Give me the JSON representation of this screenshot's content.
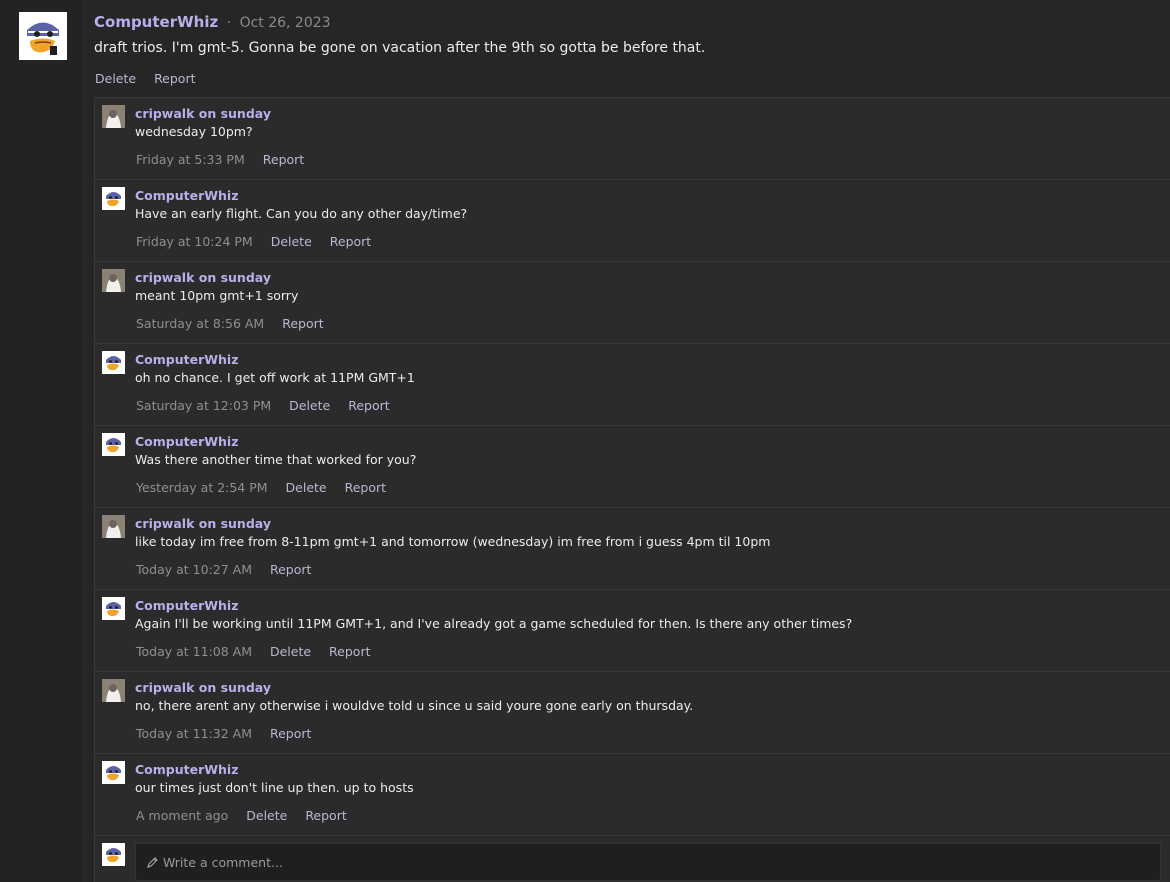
{
  "post": {
    "author": "ComputerWhiz",
    "separator": "·",
    "date": "Oct 26, 2023",
    "body": "draft trios. I'm gmt-5. Gonna be gone on vacation after the 9th so gotta be before that.",
    "actions": {
      "delete": "Delete",
      "report": "Report"
    }
  },
  "comments": [
    {
      "author": "cripwalk on sunday",
      "avatar": "user-photo",
      "text": "wednesday 10pm?",
      "time": "Friday at 5:33 PM",
      "delete": "",
      "report": "Report"
    },
    {
      "author": "ComputerWhiz",
      "avatar": "duck-avatar",
      "text": "Have an early flight. Can you do any other day/time?",
      "time": "Friday at 10:24 PM",
      "delete": "Delete",
      "report": "Report"
    },
    {
      "author": "cripwalk on sunday",
      "avatar": "user-photo",
      "text": "meant 10pm gmt+1 sorry",
      "time": "Saturday at 8:56 AM",
      "delete": "",
      "report": "Report"
    },
    {
      "author": "ComputerWhiz",
      "avatar": "duck-avatar",
      "text": "oh no chance. I get off work at 11PM GMT+1",
      "time": "Saturday at 12:03 PM",
      "delete": "Delete",
      "report": "Report"
    },
    {
      "author": "ComputerWhiz",
      "avatar": "duck-avatar",
      "text": "Was there another time that worked for you?",
      "time": "Yesterday at 2:54 PM",
      "delete": "Delete",
      "report": "Report"
    },
    {
      "author": "cripwalk on sunday",
      "avatar": "user-photo",
      "text": "like today im free from 8-11pm gmt+1 and tomorrow (wednesday) im free from i guess 4pm til 10pm",
      "time": "Today at 10:27 AM",
      "delete": "",
      "report": "Report"
    },
    {
      "author": "ComputerWhiz",
      "avatar": "duck-avatar",
      "text": "Again I'll be working until 11PM GMT+1, and I've already got a game scheduled for then. Is there any other times?",
      "time": "Today at 11:08 AM",
      "delete": "Delete",
      "report": "Report"
    },
    {
      "author": "cripwalk on sunday",
      "avatar": "user-photo",
      "text": "no, there arent any otherwise i wouldve told u since u said youre gone early on thursday.",
      "time": "Today at 11:32 AM",
      "delete": "",
      "report": "Report"
    },
    {
      "author": "ComputerWhiz",
      "avatar": "duck-avatar",
      "text": "our times just don't line up then. up to hosts",
      "time": "A moment ago",
      "delete": "Delete",
      "report": "Report"
    }
  ],
  "composer": {
    "placeholder": "Write a comment...",
    "icon": "pencil-icon"
  },
  "colors": {
    "author": "#b8b0ea",
    "link": "#b8b8d2",
    "muted": "#8f8f8f",
    "background": "#262626"
  }
}
